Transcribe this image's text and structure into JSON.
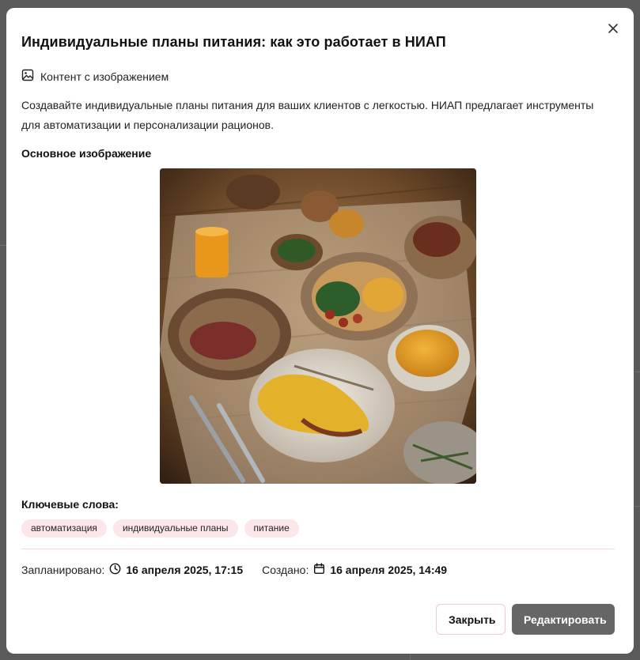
{
  "modal": {
    "title": "Индивидуальные планы питания: как это работает в НИАП",
    "close_icon": "close-icon",
    "content_type": {
      "icon": "image-icon",
      "label": "Контент с изображением"
    },
    "description": "Создавайте индивидуальные планы питания для ваших клиентов с легкостью. НИАП предлагает инструменты для автоматизации и персонализации рационов.",
    "image_section_label": "Основное изображение",
    "image": {
      "subject": "food-spread-photo"
    },
    "keywords_label": "Ключевые слова:",
    "keywords": [
      "автоматизация",
      "индивидуальные планы",
      "питание"
    ],
    "scheduled": {
      "label": "Запланировано:",
      "icon": "clock-icon",
      "value": "16 апреля 2025, 17:15"
    },
    "created": {
      "label": "Создано:",
      "icon": "calendar-icon",
      "value": "16 апреля 2025, 14:49"
    },
    "buttons": {
      "close": "Закрыть",
      "edit": "Редактировать"
    }
  },
  "colors": {
    "overlay": "#5a5a5a",
    "tag_bg": "#fde6ea",
    "primary_button": "#666666",
    "secondary_border": "#f1c9d1",
    "divider": "#f3d9de"
  }
}
